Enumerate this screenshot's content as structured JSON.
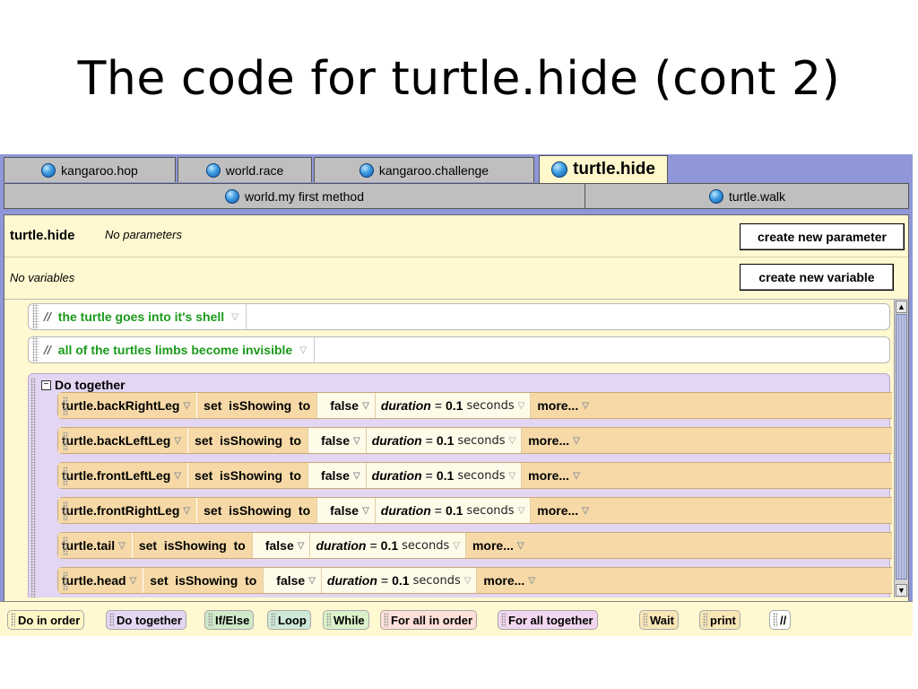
{
  "slide_title": "The code for turtle.hide (cont 2)",
  "tabs_row1": [
    {
      "label": "kangaroo.hop"
    },
    {
      "label": "world.race"
    },
    {
      "label": "kangaroo.challenge"
    },
    {
      "label": "turtle.hide"
    }
  ],
  "tabs_row2": [
    {
      "label": "world.my first method"
    },
    {
      "label": "turtle.walk"
    }
  ],
  "method": {
    "name": "turtle.hide",
    "params_text": "No parameters",
    "create_param_label": "create new parameter",
    "vars_text": "No variables",
    "create_var_label": "create new variable"
  },
  "comments": [
    {
      "slashes": "//",
      "text": "the turtle goes into it's shell"
    },
    {
      "slashes": "//",
      "text": "all of the turtles limbs become invisible"
    }
  ],
  "do_together_label": "Do together",
  "minus_symbol": "−",
  "dropdown_glyph": "▽",
  "statements": [
    {
      "object": "turtle.backRightLeg",
      "method": "set  isShowing  to",
      "value": "false",
      "duration_label": "duration",
      "equals": "=",
      "duration_value": "0.1",
      "duration_unit": "seconds",
      "more": "more..."
    },
    {
      "object": "turtle.backLeftLeg",
      "method": "set  isShowing  to",
      "value": "false",
      "duration_label": "duration",
      "equals": "=",
      "duration_value": "0.1",
      "duration_unit": "seconds",
      "more": "more..."
    },
    {
      "object": "turtle.frontLeftLeg",
      "method": "set  isShowing  to",
      "value": "false",
      "duration_label": "duration",
      "equals": "=",
      "duration_value": "0.1",
      "duration_unit": "seconds",
      "more": "more..."
    },
    {
      "object": "turtle.frontRightLeg",
      "method": "set  isShowing  to",
      "value": "false",
      "duration_label": "duration",
      "equals": "=",
      "duration_value": "0.1",
      "duration_unit": "seconds",
      "more": "more..."
    },
    {
      "object": "turtle.tail",
      "method": "set  isShowing  to",
      "value": "false",
      "duration_label": "duration",
      "equals": "=",
      "duration_value": "0.1",
      "duration_unit": "seconds",
      "more": "more..."
    },
    {
      "object": "turtle.head",
      "method": "set  isShowing  to",
      "value": "false",
      "duration_label": "duration",
      "equals": "=",
      "duration_value": "0.1",
      "duration_unit": "seconds",
      "more": "more..."
    }
  ],
  "scrollbar": {
    "up": "▲",
    "down": "▼"
  },
  "palette": [
    {
      "label": "Do in order",
      "color": "#fff6c6"
    },
    {
      "label": "Do together",
      "color": "#e3d6f2"
    },
    {
      "label": "If/Else",
      "color": "#cfe9c9"
    },
    {
      "label": "Loop",
      "color": "#cfe9d9"
    },
    {
      "label": "While",
      "color": "#d9f0c9"
    },
    {
      "label": "For all in order",
      "color": "#fde0d8"
    },
    {
      "label": "For all together",
      "color": "#f2d6ef"
    },
    {
      "label": "Wait",
      "color": "#f8e6b6"
    },
    {
      "label": "print",
      "color": "#f8e6b6"
    },
    {
      "label": "//",
      "color": "#ffffff"
    }
  ]
}
